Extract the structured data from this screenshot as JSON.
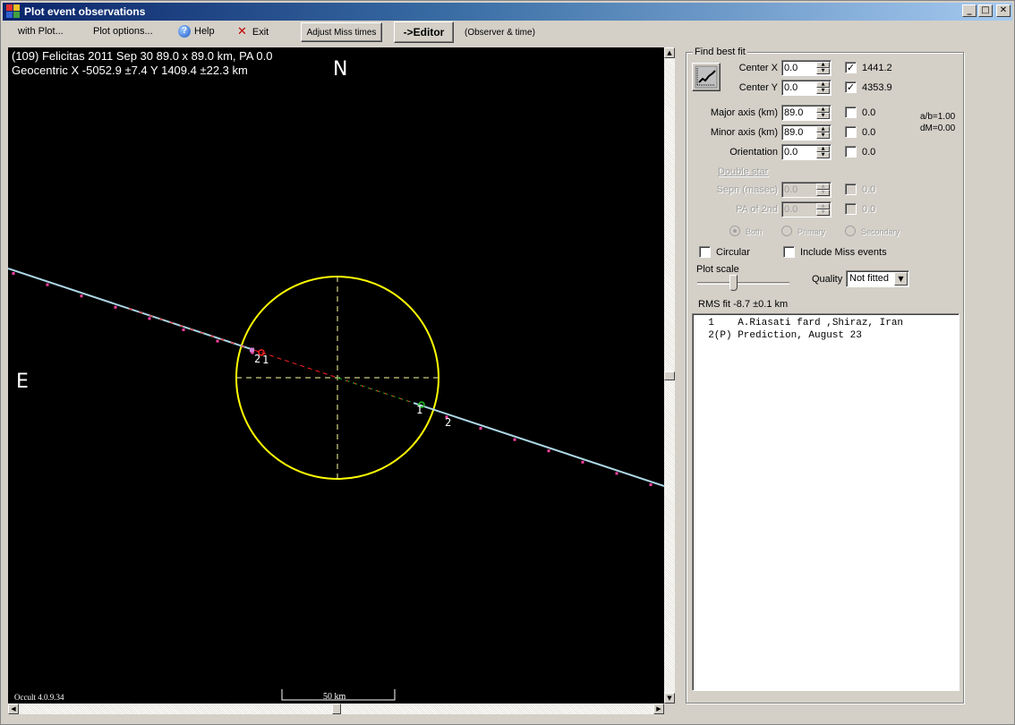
{
  "window": {
    "title": "Plot event observations",
    "controls": {
      "minimize": "_",
      "maximize": "□",
      "close": "✕"
    }
  },
  "menubar": {
    "items": [
      {
        "label": "with Plot...",
        "icon": null
      },
      {
        "label": "Plot options...",
        "icon": null
      },
      {
        "label": "Help",
        "icon": "help-icon"
      },
      {
        "label": "Exit",
        "icon": "exit-x-icon"
      }
    ],
    "adjust_miss_times": "Adjust Miss times",
    "editor": "->Editor",
    "observer_time": "(Observer & time)"
  },
  "plot": {
    "header_line1": "(109) Felicitas  2011 Sep 30  89.0 x 89.0 km, PA 0.0",
    "header_line2": "Geocentric X -5052.9 ±7.4  Y 1409.4 ±22.3 km",
    "north": "N",
    "east": "E",
    "version": "Occult 4.0.9.34",
    "scale_label": "50 km",
    "colors": {
      "background": "#000000",
      "ellipse": "#ffff00",
      "chord": "#add8e6",
      "miss_chord_marker": "#ff40a0",
      "disappear": "#ff2020",
      "reappear": "#20c020"
    },
    "chords": [
      {
        "id": "1",
        "label": "1",
        "observer": "A.Riasati fard ,Shiraz, Iran"
      },
      {
        "id": "2",
        "label": "2",
        "observer": "Prediction, August 23"
      }
    ]
  },
  "fit_panel": {
    "title": "Find best fit",
    "center_x": {
      "label": "Center X",
      "value": "0.0",
      "checked": true,
      "result": "1441.2"
    },
    "center_y": {
      "label": "Center Y",
      "value": "0.0",
      "checked": true,
      "result": "4353.9"
    },
    "major_axis": {
      "label": "Major axis (km)",
      "value": "89.0",
      "checked": false,
      "result": "0.0"
    },
    "minor_axis": {
      "label": "Minor axis (km)",
      "value": "89.0",
      "checked": false,
      "result": "0.0"
    },
    "orientation": {
      "label": "Orientation",
      "value": "0.0",
      "checked": false,
      "result": "0.0"
    },
    "ratio": "a/b=1.00",
    "dm": "dM=0.00",
    "double_star": "Double star",
    "sepn": {
      "label": "Sepn (masec)",
      "value": "0.0",
      "checked": false,
      "result": "0.0"
    },
    "pa2": {
      "label": "PA of 2nd",
      "value": "0.0",
      "checked": false,
      "result": "0.0"
    },
    "radios": [
      {
        "label": "Both",
        "selected": true
      },
      {
        "label": "Primary",
        "selected": false
      },
      {
        "label": "Secondary",
        "selected": false
      }
    ],
    "circular": {
      "label": "Circular",
      "checked": false
    },
    "include_miss": {
      "label": "Include Miss events",
      "checked": false
    },
    "plot_scale": {
      "label": "Plot scale",
      "value_fraction": 0.4
    },
    "quality": {
      "label": "Quality",
      "selected": "Not fitted"
    },
    "rms": "RMS fit -8.7 ±0.1 km",
    "observers": [
      "  1    A.Riasati fard ,Shiraz, Iran",
      "  2(P) Prediction, August 23"
    ]
  }
}
